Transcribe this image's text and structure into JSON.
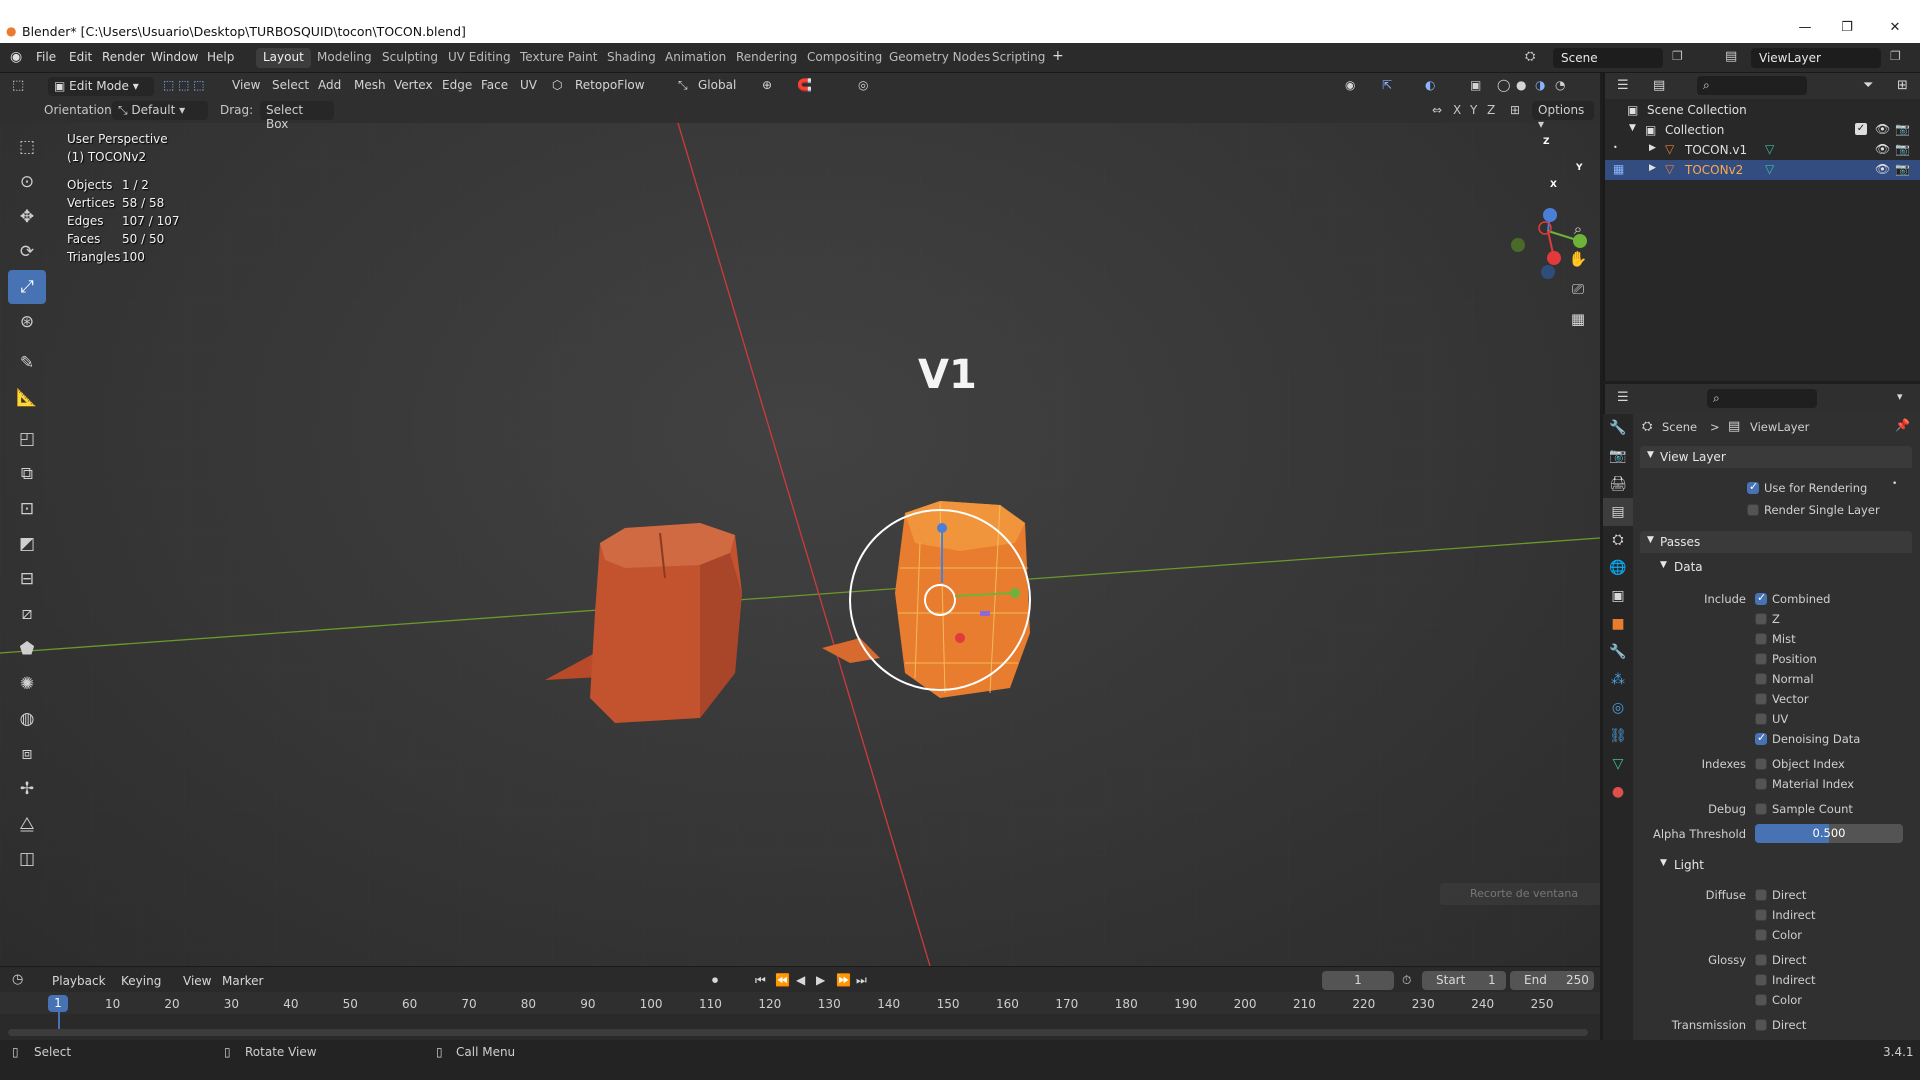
{
  "window": {
    "title": "Blender* [C:\\Users\\Usuario\\Desktop\\TURBOSQUID\\tocon\\TOCON.blend]",
    "controls": [
      "—",
      "❐",
      "✕"
    ]
  },
  "menu": [
    "File",
    "Edit",
    "Render",
    "Window",
    "Help"
  ],
  "workspaces": [
    {
      "label": "Layout",
      "active": true
    },
    {
      "label": "Modeling"
    },
    {
      "label": "Sculpting"
    },
    {
      "label": "UV Editing"
    },
    {
      "label": "Texture Paint"
    },
    {
      "label": "Shading"
    },
    {
      "label": "Animation"
    },
    {
      "label": "Rendering"
    },
    {
      "label": "Compositing"
    },
    {
      "label": "Geometry Nodes"
    },
    {
      "label": "Scripting"
    }
  ],
  "add_workspace": "+",
  "scene_field": "Scene",
  "viewlayer_field": "ViewLayer",
  "viewport_header": {
    "mode": "Edit Mode",
    "menus": [
      "View",
      "Select",
      "Add",
      "Mesh",
      "Vertex",
      "Edge",
      "Face",
      "UV"
    ],
    "addon": "RetopoFlow",
    "transform_space": "Global",
    "orientation_label": "Orientation:",
    "orientation_value": "Default",
    "drag_label": "Drag:",
    "drag_value": "Select Box",
    "axes": [
      "X",
      "Y",
      "Z"
    ],
    "options": "Options"
  },
  "overlay": {
    "perspective": "User Perspective",
    "object_name": "(1) TOCONv2",
    "stats": [
      {
        "label": "Objects",
        "value": "1 / 2"
      },
      {
        "label": "Vertices",
        "value": "58 / 58"
      },
      {
        "label": "Edges",
        "value": "107 / 107"
      },
      {
        "label": "Faces",
        "value": "50 / 50"
      },
      {
        "label": "Triangles",
        "value": "100"
      }
    ]
  },
  "viewport_text": "V1",
  "tooltip_ghost": "Recorte de ventana",
  "gizmo": {
    "x": "X",
    "y": "Y",
    "z": "Z"
  },
  "outliner": {
    "root": "Scene Collection",
    "collection": "Collection",
    "objects": [
      {
        "name": "TOCON.v1",
        "selected": false
      },
      {
        "name": "TOCONv2",
        "selected": true
      }
    ]
  },
  "properties": {
    "breadcrumb_scene": "Scene",
    "breadcrumb_sep": ">",
    "breadcrumb_viewlayer": "ViewLayer",
    "view_layer": {
      "title": "View Layer",
      "use_for_rendering": {
        "label": "Use for Rendering",
        "checked": true
      },
      "render_single_layer": {
        "label": "Render Single Layer",
        "checked": false
      }
    },
    "passes_title": "Passes",
    "data_title": "Data",
    "include_label": "Include",
    "include": [
      {
        "label": "Combined",
        "checked": true
      },
      {
        "label": "Z",
        "checked": false
      },
      {
        "label": "Mist",
        "checked": false
      },
      {
        "label": "Position",
        "checked": false
      },
      {
        "label": "Normal",
        "checked": false
      },
      {
        "label": "Vector",
        "checked": false
      },
      {
        "label": "UV",
        "checked": false
      },
      {
        "label": "Denoising Data",
        "checked": true
      }
    ],
    "indexes_label": "Indexes",
    "indexes": [
      {
        "label": "Object Index",
        "checked": false
      },
      {
        "label": "Material Index",
        "checked": false
      }
    ],
    "debug_label": "Debug",
    "debug": {
      "label": "Sample Count",
      "checked": false
    },
    "alpha_label": "Alpha Threshold",
    "alpha_value": "0.500",
    "light_title": "Light",
    "diffuse_label": "Diffuse",
    "diffuse": [
      "Direct",
      "Indirect",
      "Color"
    ],
    "glossy_label": "Glossy",
    "glossy": [
      "Direct",
      "Indirect",
      "Color"
    ],
    "transmission_label": "Transmission",
    "transmission": [
      "Direct"
    ]
  },
  "timeline": {
    "menus": [
      "Playback",
      "Keying",
      "View",
      "Marker"
    ],
    "current_frame": "1",
    "start_label": "Start",
    "start": "1",
    "end_label": "End",
    "end": "250",
    "ticks": [
      "1",
      "10",
      "20",
      "30",
      "40",
      "50",
      "60",
      "70",
      "80",
      "90",
      "100",
      "110",
      "120",
      "130",
      "140",
      "150",
      "160",
      "170",
      "180",
      "190",
      "200",
      "210",
      "220",
      "230",
      "240",
      "250"
    ]
  },
  "status": {
    "select": "Select",
    "rotate": "Rotate View",
    "menu": "Call Menu",
    "version": "3.4.1"
  },
  "colors": {
    "accent": "#4772b3",
    "mesh_orange": "#c2532e",
    "selected_orange": "#e87d2f",
    "x_axis": "#d03a3a",
    "y_axis": "#6a9a2a"
  }
}
